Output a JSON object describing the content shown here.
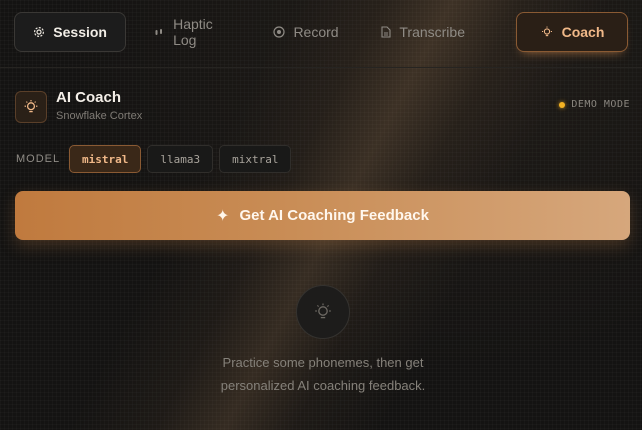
{
  "tabs": [
    {
      "label": "Session",
      "icon": "gear-icon"
    },
    {
      "label": "Haptic Log",
      "icon": "vibration-icon"
    },
    {
      "label": "Record",
      "icon": "record-icon"
    },
    {
      "label": "Transcribe",
      "icon": "document-icon"
    },
    {
      "label": "Coach",
      "icon": "lightbulb-icon"
    }
  ],
  "active_tab": "Coach",
  "header": {
    "title": "AI Coach",
    "subtitle": "Snowflake Cortex",
    "status": "DEMO MODE",
    "icon": "lightbulb-icon"
  },
  "model": {
    "label": "MODEL",
    "options": [
      "mistral",
      "llama3",
      "mixtral"
    ],
    "selected": "mistral"
  },
  "cta": {
    "label": "Get AI Coaching Feedback",
    "icon": "sparkle-icon"
  },
  "empty_state": {
    "icon": "lightbulb-icon",
    "message": "Practice some phonemes, then get personalized AI coaching feedback."
  },
  "colors": {
    "accent": "#c98d56",
    "accent_text": "#f0b888",
    "status_dot": "#f5b323",
    "background": "#141312"
  }
}
